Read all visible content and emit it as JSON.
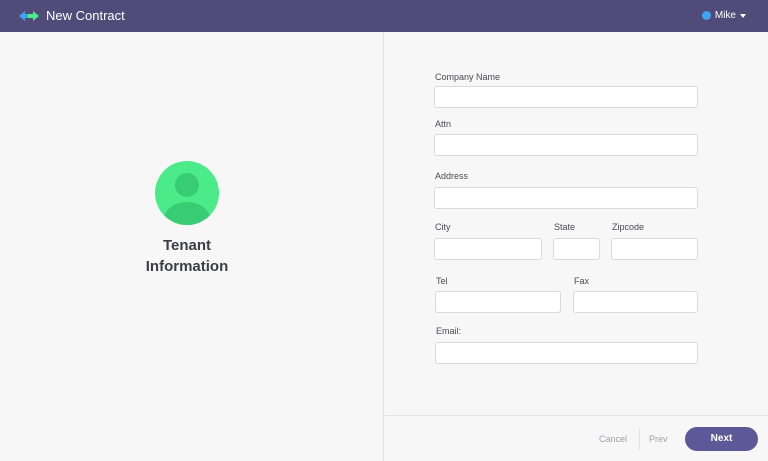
{
  "header": {
    "title": "New Contract",
    "logo_icon": "swap-arrows-icon",
    "user_name": "Mike",
    "user_status_color": "#3ea3f0"
  },
  "left": {
    "avatar_icon": "user-avatar-icon",
    "avatar_color": "#4ceb8a",
    "title_line1": "Tenant",
    "title_line2": "Information"
  },
  "form": {
    "company_name": {
      "label": "Company Name",
      "value": ""
    },
    "attn": {
      "label": "Attn",
      "value": ""
    },
    "address": {
      "label": "Address",
      "value": ""
    },
    "city": {
      "label": "City",
      "value": ""
    },
    "state": {
      "label": "State",
      "value": ""
    },
    "zipcode": {
      "label": "Zipcode",
      "value": ""
    },
    "tel": {
      "label": "Tel",
      "value": ""
    },
    "fax": {
      "label": "Fax",
      "value": ""
    },
    "email": {
      "label": "Email:",
      "value": ""
    }
  },
  "footer": {
    "cancel": "Cancel",
    "prev": "Prev",
    "next": "Next"
  },
  "colors": {
    "header_bg": "#514b7a",
    "next_button": "#5d5897"
  }
}
